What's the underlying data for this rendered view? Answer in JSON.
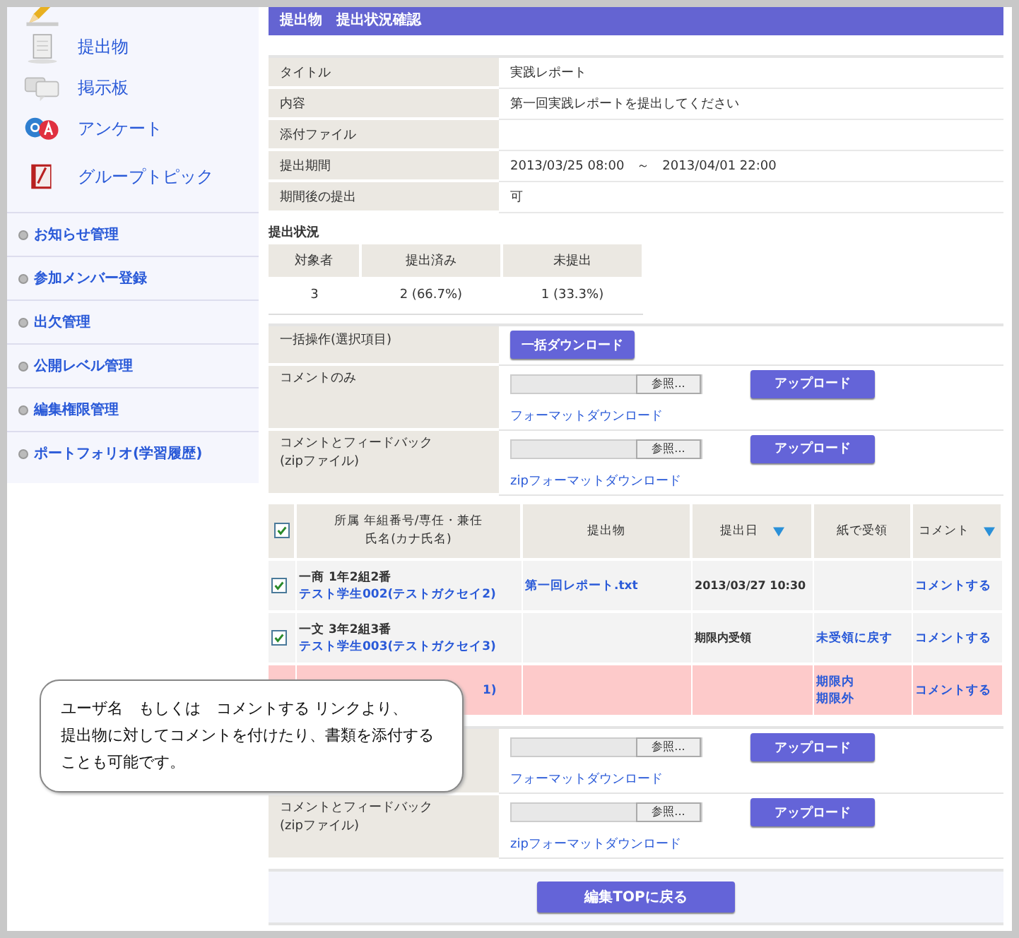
{
  "sidebar": {
    "main_items": [
      {
        "kind": "pencil"
      },
      {
        "label": "提出物",
        "kind": "document"
      },
      {
        "label": "掲示板",
        "kind": "chat"
      },
      {
        "label": "アンケート",
        "kind": "qa"
      },
      {
        "label": "グループトピック",
        "kind": "topic"
      }
    ],
    "admin_items": [
      "お知らせ管理",
      "参加メンバー登録",
      "出欠管理",
      "公開レベル管理",
      "編集権限管理",
      "ポートフォリオ(学習履歴)"
    ]
  },
  "header": {
    "title": "提出物　提出状況確認"
  },
  "info": [
    {
      "label": "タイトル",
      "value": "実践レポート"
    },
    {
      "label": "内容",
      "value": "第一回実践レポートを提出してください"
    },
    {
      "label": "添付ファイル"
    },
    {
      "label": "提出期間",
      "value": "2013/03/25 08:00　～　2013/04/01 22:00"
    },
    {
      "label": "期間後の提出",
      "value": "可"
    }
  ],
  "status": {
    "heading": "提出状況",
    "columns": [
      "対象者",
      "提出済み",
      "未提出"
    ],
    "values": [
      "3",
      "2 (66.7%)",
      "1 (33.3%)"
    ]
  },
  "batch": {
    "label": "一括操作(選択項目)",
    "button": "一括ダウンロード"
  },
  "uploads_top": [
    {
      "label": "コメントのみ",
      "browse": "参照...",
      "upload": "アップロード",
      "link": "フォーマットダウンロード"
    },
    {
      "label": "コメントとフィードバック\n(zipファイル)",
      "browse": "参照...",
      "upload": "アップロード",
      "link": "zipフォーマットダウンロード"
    }
  ],
  "table": {
    "header_checked": true,
    "columns": [
      {
        "lines": [
          "所属 年組番号/専任・兼任",
          "氏名(カナ氏名)"
        ],
        "sortable": false
      },
      {
        "label": "提出物",
        "sortable": false
      },
      {
        "label": "提出日",
        "sortable": true
      },
      {
        "label": "紙で受領",
        "sortable": false
      },
      {
        "label": "コメント",
        "sortable": true
      }
    ],
    "rows": [
      {
        "checked": true,
        "highlighted": false,
        "class": "一商 1年2組2番",
        "name": "テスト学生002(テストガクセイ2)",
        "file": "第一回レポート.txt",
        "date": "2013/03/27 10:30",
        "paper_links": [],
        "comment": "コメントする"
      },
      {
        "checked": true,
        "highlighted": false,
        "class": "一文 3年2組3番",
        "name": "テスト学生003(テストガクセイ3)",
        "date": "期限内受領",
        "paper_links": [
          "未受領に戻す"
        ],
        "comment": "コメントする"
      },
      {
        "highlighted": true,
        "name": "1)",
        "paper_links": [
          "期限内",
          "期限外"
        ],
        "comment": "コメントする"
      }
    ]
  },
  "uploads_bottom": [
    {
      "browse": "参照...",
      "upload": "アップロード",
      "link": "フォーマットダウンロード"
    },
    {
      "label": "コメントとフィードバック\n(zipファイル)",
      "browse": "参照...",
      "upload": "アップロード",
      "link": "zipフォーマットダウンロード"
    }
  ],
  "footer": {
    "button": "編集TOPに戻る"
  },
  "callout": {
    "lines": [
      "ユーザ名　もしくは　コメントする リンクより、",
      "提出物に対してコメントを付けたり、書類を添付することも可能です。"
    ]
  }
}
